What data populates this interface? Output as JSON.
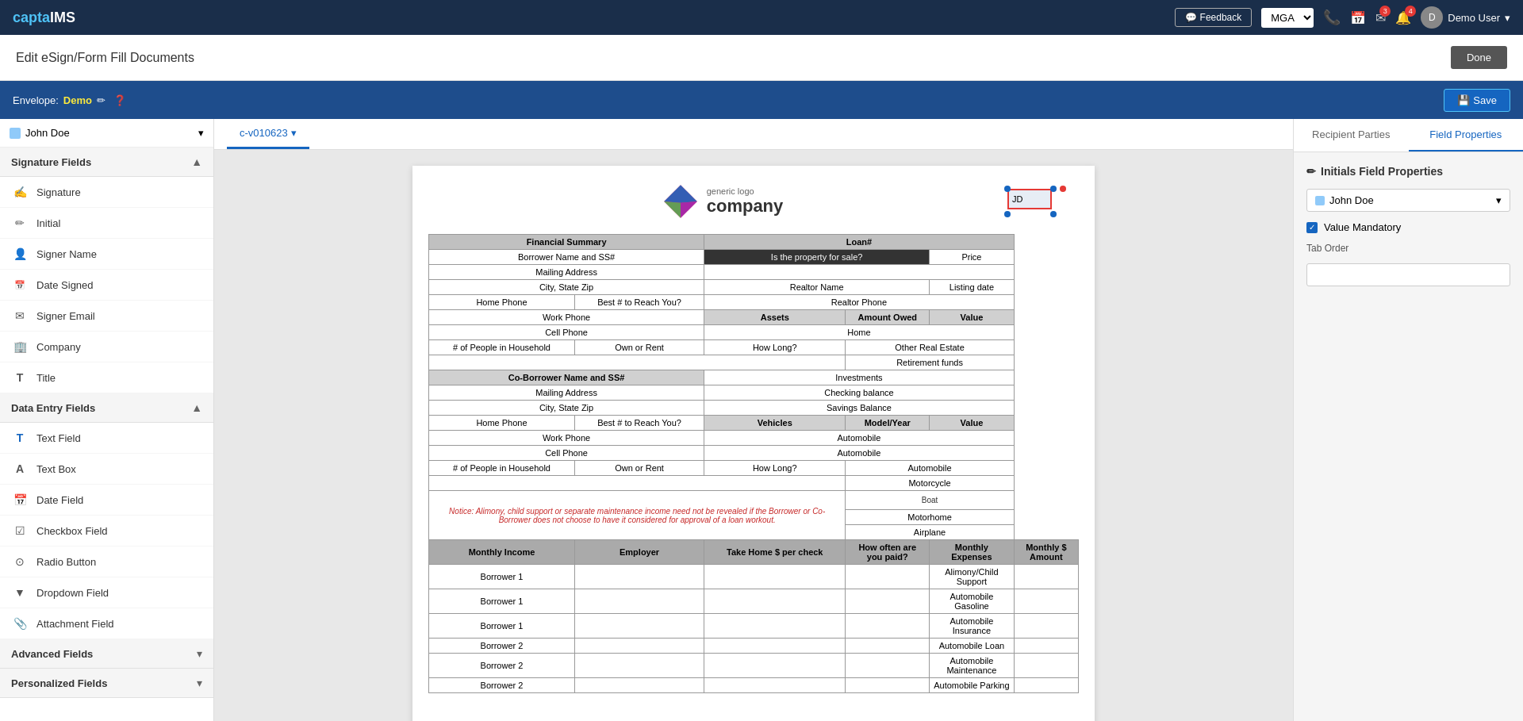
{
  "topNav": {
    "logo": "captaIMS",
    "logo_highlight": "capta",
    "feedback_label": "Feedback",
    "mga_value": "MGA",
    "user_label": "Demo User",
    "notifications": {
      "email": "3",
      "bell": "4"
    }
  },
  "pageHeader": {
    "title": "Edit eSign/Form Fill Documents",
    "done_label": "Done"
  },
  "envelopeBar": {
    "label": "Envelope:",
    "name": "Demo",
    "save_label": "Save"
  },
  "docTab": {
    "id": "c-v010623",
    "label": "c-v010623"
  },
  "leftSidebar": {
    "recipient": "John Doe",
    "signatureFields": {
      "title": "Signature Fields",
      "items": [
        {
          "label": "Signature",
          "icon": "✍"
        },
        {
          "label": "Initial",
          "icon": "✏"
        },
        {
          "label": "Signer Name",
          "icon": "👤"
        },
        {
          "label": "Date Signed",
          "icon": "📅"
        },
        {
          "label": "Signer Email",
          "icon": "✉"
        },
        {
          "label": "Company",
          "icon": "🏢"
        },
        {
          "label": "Title",
          "icon": "T"
        }
      ]
    },
    "dataEntryFields": {
      "title": "Data Entry Fields",
      "items": [
        {
          "label": "Text Field",
          "icon": "T"
        },
        {
          "label": "Text Box",
          "icon": "A"
        },
        {
          "label": "Date Field",
          "icon": "📅"
        },
        {
          "label": "Checkbox Field",
          "icon": "☑"
        },
        {
          "label": "Radio Button",
          "icon": "⊙"
        },
        {
          "label": "Dropdown Field",
          "icon": "▼"
        },
        {
          "label": "Attachment Field",
          "icon": "📎"
        }
      ]
    },
    "advancedFields": {
      "title": "Advanced Fields"
    },
    "personalizedFields": {
      "title": "Personalized Fields"
    }
  },
  "document": {
    "companyName": "generic logo",
    "companyNameBig": "company",
    "initialsLabel": "JD",
    "table": {
      "headers": [
        "Financial Summary",
        "",
        "Loan#",
        "",
        ""
      ],
      "rows": [
        [
          "Borrower Name and SS#",
          "",
          "Is the property for sale?",
          "",
          "Price"
        ],
        [
          "Mailing Address",
          "",
          "",
          "",
          ""
        ],
        [
          "City, State Zip",
          "",
          "Realtor Name",
          "",
          "Listing date"
        ],
        [
          "Home Phone",
          "Best # to Reach You?",
          "Realtor Phone",
          "",
          ""
        ],
        [
          "Work Phone",
          "",
          "Assets",
          "Amount Owed",
          "Value"
        ],
        [
          "Cell Phone",
          "",
          "Home",
          "",
          ""
        ],
        [
          "# of People in Household",
          "Own or Rent",
          "How Long?",
          "Other Real Estate",
          ""
        ],
        [
          "",
          "",
          "",
          "Retirement funds",
          ""
        ],
        [
          "Co-Borrower Name and SS#",
          "",
          "Investments",
          "",
          ""
        ],
        [
          "Mailing Address",
          "",
          "Checking balance",
          "",
          ""
        ],
        [
          "City, State Zip",
          "",
          "Savings Balance",
          "",
          ""
        ],
        [
          "Home Phone",
          "Best # to Reach You?",
          "Vehicles",
          "Model/Year",
          "Value"
        ],
        [
          "Work Phone",
          "",
          "Automobile",
          "",
          ""
        ],
        [
          "Cell Phone",
          "",
          "Automobile",
          "",
          ""
        ],
        [
          "# of People in Household",
          "Own or Rent",
          "How Long?",
          "Automobile",
          ""
        ],
        [
          "",
          "",
          "",
          "Motorcycle",
          ""
        ],
        [
          "",
          "",
          "",
          "Boat",
          ""
        ],
        [
          "",
          "",
          "",
          "Motorhome",
          ""
        ],
        [
          "",
          "",
          "",
          "Airplane",
          ""
        ],
        [
          "Monthly Income",
          "Employer",
          "Take Home $ per check",
          "How often are you paid?",
          "Monthly Expenses",
          "Monthly $ Amount"
        ],
        [
          "Borrower 1",
          "",
          "",
          "",
          "Alimony/Child Support",
          ""
        ],
        [
          "Borrower 1",
          "",
          "",
          "",
          "Automobile Gasoline",
          ""
        ],
        [
          "Borrower 1",
          "",
          "",
          "",
          "Automobile Insurance",
          ""
        ],
        [
          "Borrower 2",
          "",
          "",
          "",
          "Automobile Loan",
          ""
        ],
        [
          "Borrower 2",
          "",
          "",
          "",
          "Automobile Maintenance",
          ""
        ],
        [
          "Borrower 2",
          "",
          "",
          "",
          "Automobile Parking",
          ""
        ]
      ],
      "notice": "Notice: Alimony, child support or separate maintenance income need not be revealed if the Borrower or Co-Borrower does not choose to have it considered for approval of a loan workout."
    }
  },
  "rightPanel": {
    "tabs": [
      {
        "label": "Recipient Parties",
        "active": false
      },
      {
        "label": "Field Properties",
        "active": true
      }
    ],
    "fieldProperties": {
      "title": "Initials Field Properties",
      "recipientLabel": "John Doe",
      "valueMandatory": "Value Mandatory",
      "valueMandatoryChecked": true,
      "tabOrderLabel": "Tab Order",
      "tabOrderValue": ""
    }
  }
}
